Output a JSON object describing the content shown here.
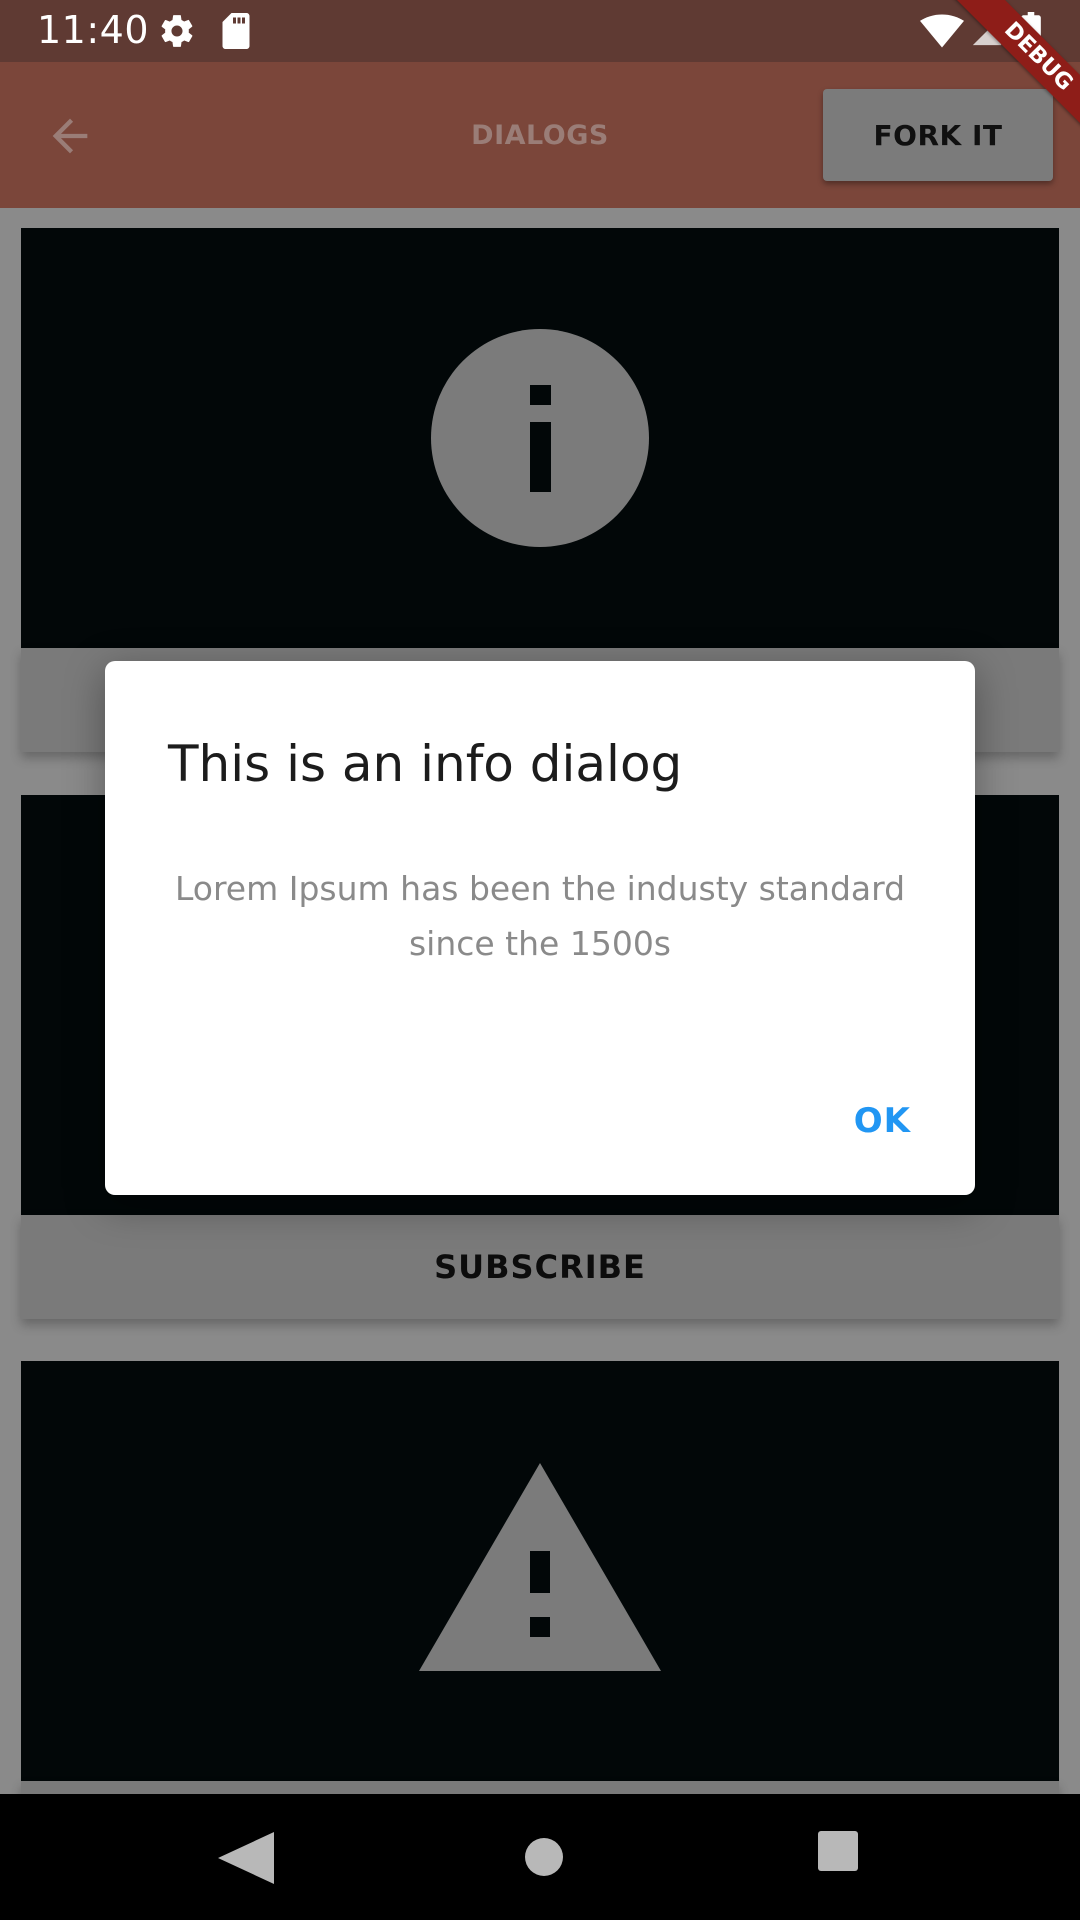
{
  "status_bar": {
    "time": "11:40",
    "icons": [
      "gear-icon",
      "sd-card-icon",
      "wifi-icon",
      "signal-icon",
      "battery-icon"
    ]
  },
  "app_bar": {
    "title": "DIALOGS",
    "back_icon": "arrow-back-icon",
    "action_label": "FORK IT"
  },
  "debug_banner": "DEBUG",
  "cards": [
    {
      "icon": "info-circle-icon",
      "action_label": ""
    },
    {
      "icon": "",
      "action_label": "SUBSCRIBE"
    },
    {
      "icon": "warning-triangle-icon",
      "action_label": ""
    }
  ],
  "dialog": {
    "title": "This is an info dialog",
    "body": "Lorem Ipsum has been the industy standard since the 1500s",
    "ok_label": "OK"
  },
  "nav_bar": {
    "icons": [
      "nav-back-icon",
      "nav-home-icon",
      "nav-recents-icon"
    ]
  },
  "colors": {
    "status_bar": "#5f3a33",
    "app_bar": "#7b463a",
    "dialog_accent": "#2196f3",
    "debug_banner": "#8e1d18",
    "card_media": "#020708",
    "scrim_background": "#8a8a8a"
  }
}
